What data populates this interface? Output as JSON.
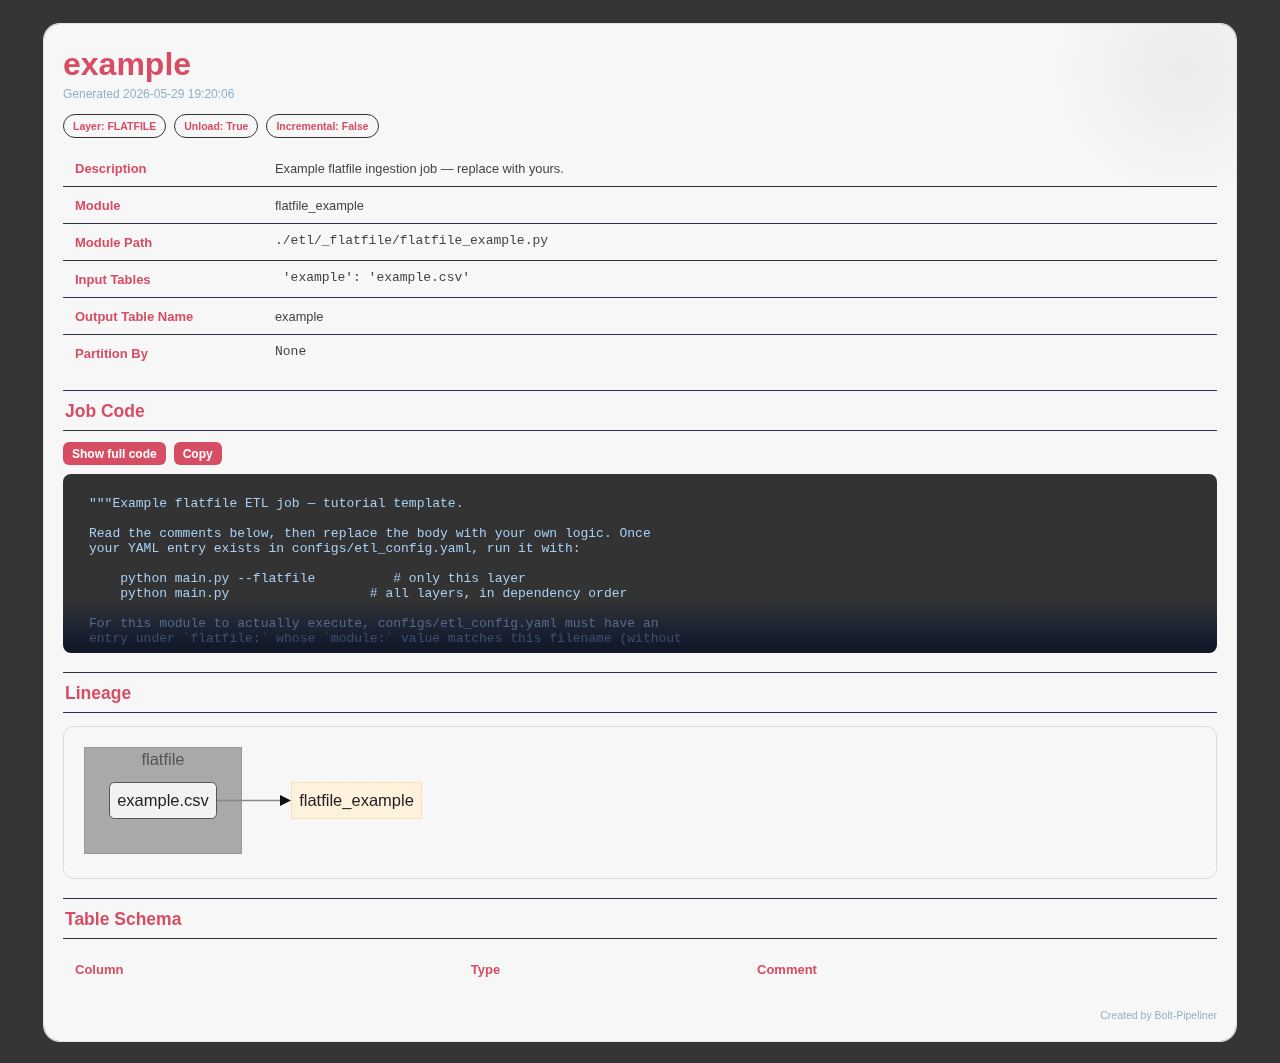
{
  "title": "example",
  "generated": "Generated 2026-05-29 19:20:06",
  "badges": [
    "Layer: FLATFILE",
    "Unload: True",
    "Incremental: False"
  ],
  "details": [
    {
      "label": "Description",
      "value": "Example flatfile ingestion job — replace with yours.",
      "kind": "text"
    },
    {
      "label": "Module",
      "value": "flatfile_example",
      "kind": "text"
    },
    {
      "label": "Module Path",
      "value": "./etl/_flatfile/flatfile_example.py",
      "kind": "code"
    },
    {
      "label": "Input Tables",
      "value": " 'example': 'example.csv'",
      "kind": "code"
    },
    {
      "label": "Output Table Name",
      "value": "example",
      "kind": "text"
    },
    {
      "label": "Partition By",
      "value": "None",
      "kind": "code"
    }
  ],
  "job_code": {
    "heading": "Job Code",
    "actions": [
      "Show full code",
      "Copy"
    ],
    "code": "\"\"\"Example flatfile ETL job — tutorial template.\n\nRead the comments below, then replace the body with your own logic. Once\nyour YAML entry exists in configs/etl_config.yaml, run it with:\n\n    python main.py --flatfile          # only this layer\n    python main.py                  # all layers, in dependency order\n\nFor this module to actually execute, configs/etl_config.yaml must have an\nentry under `flatfile:` whose `module:` value matches this filename (without"
  },
  "lineage": {
    "heading": "Lineage",
    "cluster": {
      "label": "flatfile",
      "nodes": [
        {
          "label": "example.csv",
          "kind": "source"
        }
      ]
    },
    "nodes": [
      {
        "label": "flatfile_example",
        "kind": "job"
      }
    ]
  },
  "table_schema": {
    "heading": "Table Schema",
    "columns": [
      "Column",
      "Type",
      "Comment"
    ]
  },
  "footer": "Created by Bolt-Pipeliner"
}
